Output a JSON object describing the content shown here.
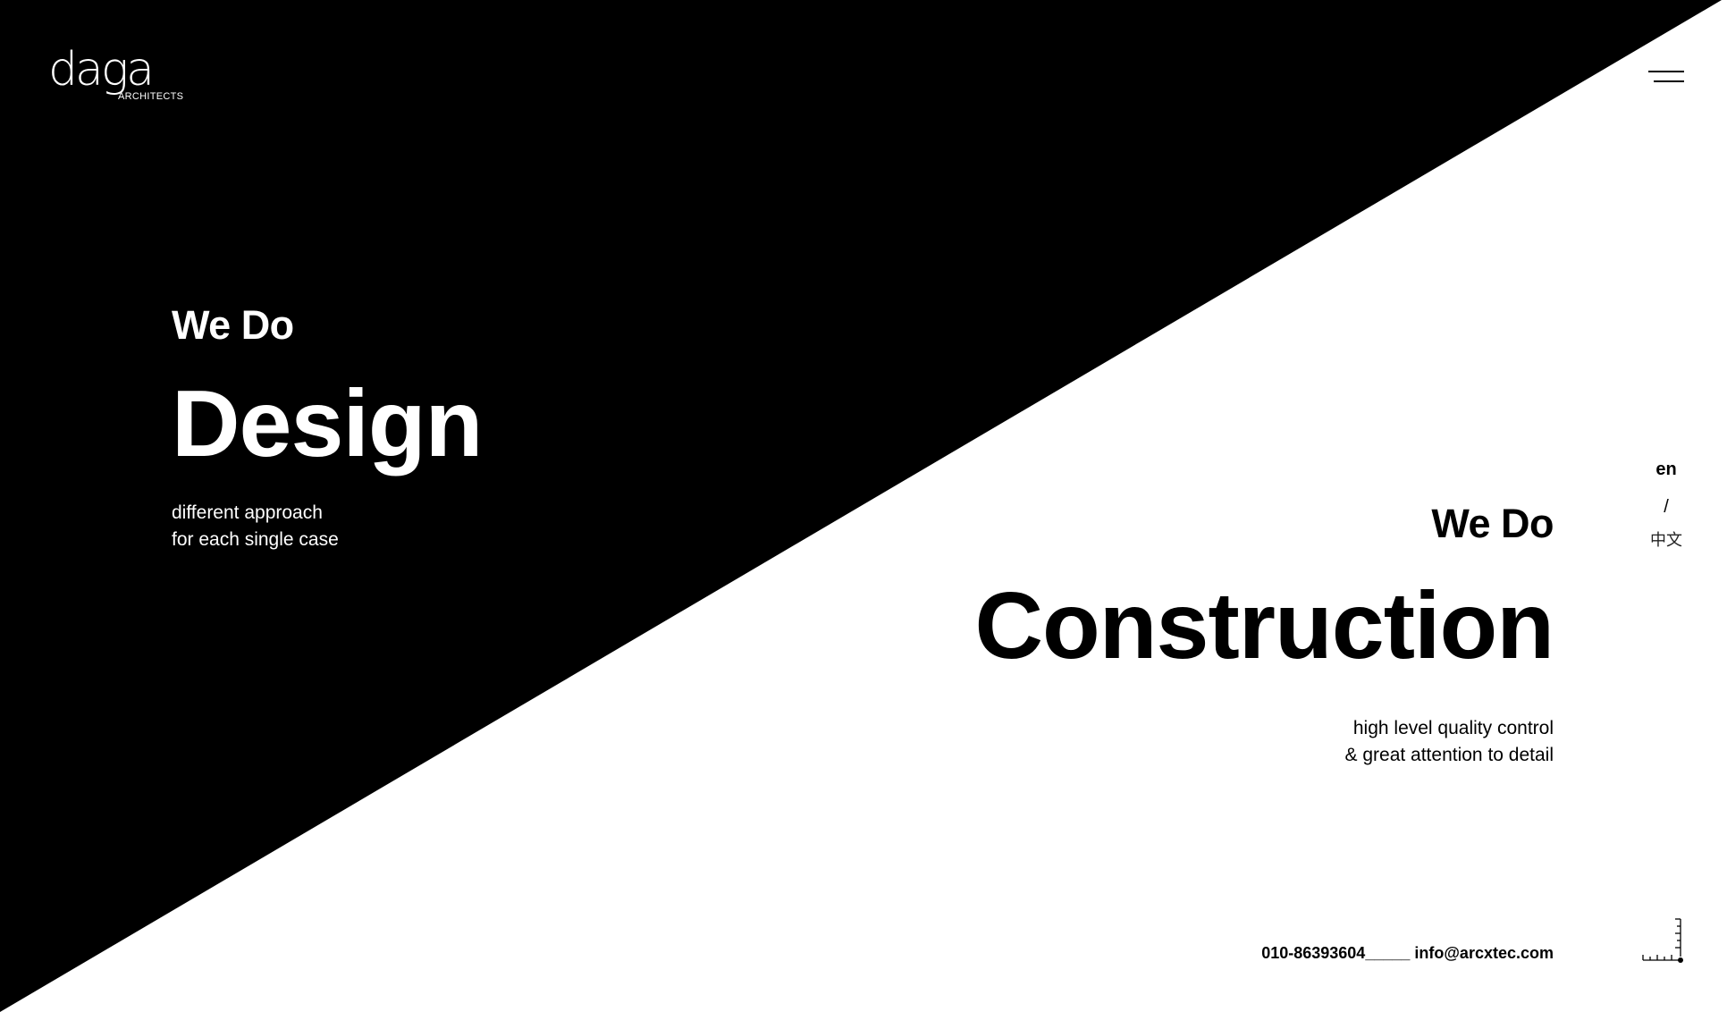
{
  "brand": {
    "logo_text": "daga",
    "logo_sub": "ARCHITECTS"
  },
  "header": {
    "menu_icon": "hamburger-menu-icon"
  },
  "colors": {
    "dark_panel": "#000000",
    "light_panel": "#ffffff"
  },
  "design": {
    "prefix": "We Do",
    "title": "Design",
    "tagline_1": "different approach",
    "tagline_2": "for each single case"
  },
  "construction": {
    "prefix": "We Do",
    "title": "Construction",
    "tagline_1": "high level quality control",
    "tagline_2": "& great attention to detail"
  },
  "language": {
    "en": "en",
    "separator": "/",
    "zh": "中文"
  },
  "contact": {
    "phone": "010-86393604",
    "separator": "_____",
    "email": "info@arcxtec.com"
  },
  "scroll_indicator_icon": "ruler-scroll-icon"
}
